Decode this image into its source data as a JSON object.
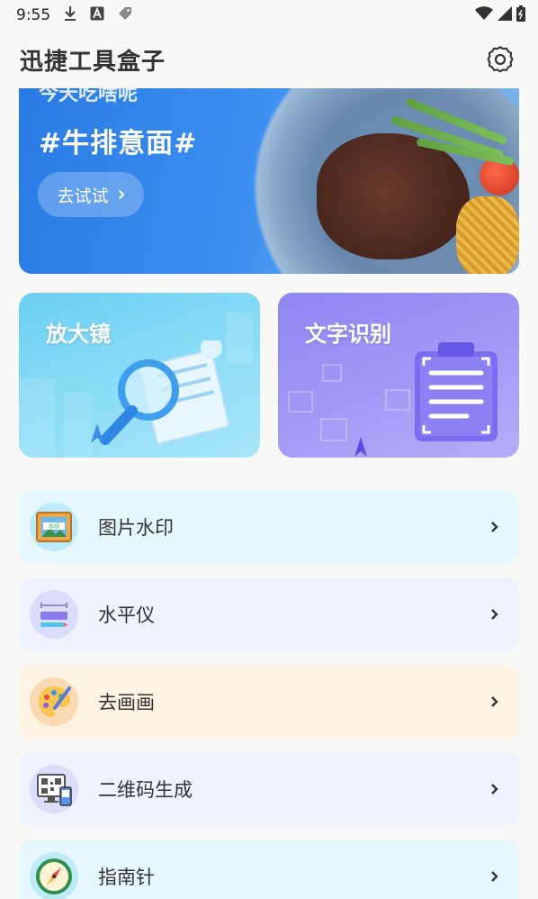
{
  "status_bar": {
    "time": "9:55"
  },
  "app_bar": {
    "title": "迅捷工具盒子"
  },
  "banner": {
    "subtitle": "今天吃啥呢",
    "title": "#牛排意面#",
    "button_label": "去试试"
  },
  "tiles": [
    {
      "label": "放大镜"
    },
    {
      "label": "文字识别"
    }
  ],
  "list": [
    {
      "label": "图片水印",
      "bg": "#e6f8fd"
    },
    {
      "label": "水平仪",
      "bg": "#eef3fd"
    },
    {
      "label": "去画画",
      "bg": "#fef4e4"
    },
    {
      "label": "二维码生成",
      "bg": "#eef3fd"
    },
    {
      "label": "指南针",
      "bg": "#e6f8fd"
    }
  ]
}
